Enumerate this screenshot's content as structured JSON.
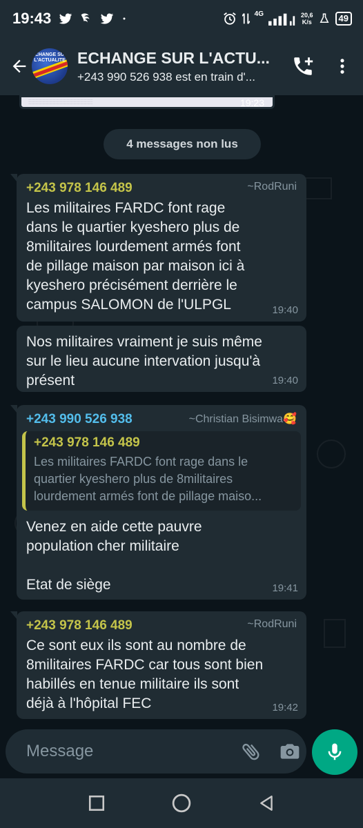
{
  "status_bar": {
    "time": "19:43",
    "network_speed_value": "20,6",
    "network_speed_unit": "K/s",
    "battery": "49",
    "signal_label": "4G"
  },
  "header": {
    "title": "ECHANGE SUR L'ACTU...",
    "subtitle": "+243 990 526 938 est en train d'...",
    "avatar_text": "ECHANGE SUR L'ACTUALITE"
  },
  "chat": {
    "previous_image_time": "19:23",
    "unread_label": "4 messages non lus",
    "messages": [
      {
        "sender": "+243 978 146 489",
        "pushname": "~RodRuni",
        "text": "Les militaires FARDC font rage\ndans le quartier kyeshero plus de\n8militaires lourdement armés font\nde pillage maison par maison ici à\nkyeshero précisément derrière le\ncampus SALOMON de l'ULPGL",
        "time": "19:40"
      },
      {
        "text": "Nos militaires vraiment je suis même\nsur le lieu aucune intervation jusqu'à\nprésent",
        "time": "19:40"
      },
      {
        "sender": "+243 990 526 938",
        "pushname": "~Christian Bisimwa🥰",
        "quote_sender": "+243 978 146 489",
        "quote_text": "Les militaires FARDC font rage dans le\nquartier kyeshero plus de 8militaires\nlourdement armés font de pillage maiso...",
        "text": "Venez en aide cette pauvre\npopulation cher militaire\n\nEtat de siège",
        "time": "19:41"
      },
      {
        "sender": "+243 978 146 489",
        "pushname": "~RodRuni",
        "text": "Ce sont eux ils sont au nombre de\n8militaires FARDC car tous sont bien\nhabillés en tenue militaire ils sont\ndéjà à l'hôpital FEC",
        "time": "19:42"
      }
    ]
  },
  "composer": {
    "placeholder": "Message"
  },
  "colors": {
    "background": "#0b141a",
    "bar": "#1f2c34",
    "bubble": "#202c33",
    "accent": "#00a884",
    "sender_yellow": "#c4c44a",
    "sender_blue": "#53bdeb"
  },
  "icons": [
    "back-arrow-icon",
    "add-call-icon",
    "more-vert-icon",
    "emoji-icon",
    "attach-icon",
    "camera-icon",
    "mic-icon",
    "nav-recents-icon",
    "nav-home-icon",
    "nav-back-icon"
  ]
}
